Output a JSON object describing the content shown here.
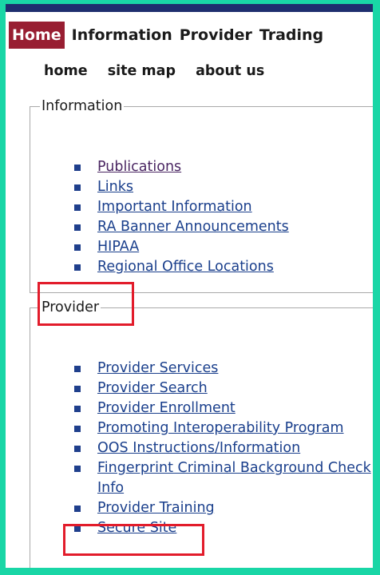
{
  "main_nav": {
    "items": [
      {
        "label": "Home",
        "active": true
      },
      {
        "label": "Information",
        "active": false
      },
      {
        "label": "Provider",
        "active": false
      },
      {
        "label": "Trading",
        "active": false
      }
    ]
  },
  "sub_nav": {
    "items": [
      {
        "label": "home"
      },
      {
        "label": "site map"
      },
      {
        "label": "about us"
      }
    ]
  },
  "information_section": {
    "legend": "Information",
    "links": [
      {
        "label": "Publications"
      },
      {
        "label": "Links"
      },
      {
        "label": "Important Information"
      },
      {
        "label": "RA Banner Announcements"
      },
      {
        "label": "HIPAA"
      },
      {
        "label": "Regional Office Locations"
      }
    ]
  },
  "provider_section": {
    "legend": "Provider",
    "links": [
      {
        "label": "Provider Services"
      },
      {
        "label": "Provider Search"
      },
      {
        "label": "Provider Enrollment"
      },
      {
        "label": "Promoting Interoperability Program"
      },
      {
        "label": "OOS Instructions/Information"
      },
      {
        "label": "Fingerprint Criminal Background Check Info"
      },
      {
        "label": "Provider Training"
      },
      {
        "label": "Secure Site"
      }
    ]
  },
  "colors": {
    "frame_border": "#19d6a6",
    "nav_active_bg": "#981e32",
    "link": "#1a3f8c",
    "visited_link": "#4b2763",
    "highlight": "#e21c2b",
    "bullet": "#1f3f8c"
  }
}
